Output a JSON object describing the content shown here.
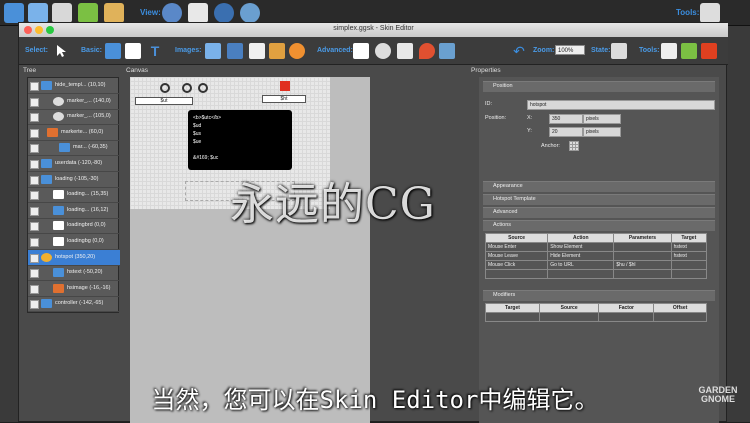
{
  "top_toolbar": {
    "view_label": "View:",
    "tools_label": "Tools:"
  },
  "window": {
    "title": "simplex.ggsk - Skin Editor"
  },
  "toolbar": {
    "select_label": "Select:",
    "basic_label": "Basic:",
    "images_label": "Images:",
    "advanced_label": "Advanced:",
    "zoom_label": "Zoom:",
    "zoom_value": "100%",
    "state_label": "State:",
    "tools_label": "Tools:"
  },
  "panels": {
    "tree": "Tree",
    "canvas": "Canvas",
    "properties": "Properties"
  },
  "tree_items": [
    {
      "label": "hide_templ... (10,10)",
      "indent": 0,
      "kind": "folder"
    },
    {
      "label": "marker_... (140,0)",
      "indent": 2,
      "kind": "circle"
    },
    {
      "label": "marker_... (105,0)",
      "indent": 2,
      "kind": "circle"
    },
    {
      "label": "markerte... (60,0)",
      "indent": 1,
      "kind": "marker"
    },
    {
      "label": "mar... (-60,35)",
      "indent": 3,
      "kind": "text"
    },
    {
      "label": "userdata (-120,-80)",
      "indent": 0,
      "kind": "folder"
    },
    {
      "label": "loading (-105,-30)",
      "indent": 0,
      "kind": "folder"
    },
    {
      "label": "loading... (15,35)",
      "indent": 2,
      "kind": "rect"
    },
    {
      "label": "loading... (16,12)",
      "indent": 2,
      "kind": "text"
    },
    {
      "label": "loadingbrd (0,0)",
      "indent": 2,
      "kind": "rect"
    },
    {
      "label": "loadingbg (0,0)",
      "indent": 2,
      "kind": "rect"
    },
    {
      "label": "hotspot (350,20)",
      "indent": 0,
      "kind": "hotspot",
      "selected": true
    },
    {
      "label": "hstext (-50,20)",
      "indent": 2,
      "kind": "text"
    },
    {
      "label": "hsimage (-16,-16)",
      "indent": 2,
      "kind": "marker"
    },
    {
      "label": "controller (-142,-65)",
      "indent": 0,
      "kind": "folder"
    }
  ],
  "canvas": {
    "label_ut": "$ut",
    "label_ht": "$ht",
    "textbox_lines": [
      "<b>$utc</b>",
      "$ud",
      "$us",
      "$ue",
      "",
      "&#169; $uc"
    ]
  },
  "properties": {
    "position_header": "Position",
    "id_label": "ID:",
    "id_value": "hotspot",
    "position_label": "Position:",
    "x_label": "X:",
    "x_value": "350",
    "y_label": "Y:",
    "y_value": "20",
    "unit": "pixels",
    "anchor_label": "Anchor:",
    "appearance_header": "Appearance",
    "hotspot_template_header": "Hotspot Template",
    "advanced_header": "Advanced",
    "actions_header": "Actions",
    "actions_columns": [
      "Source",
      "Action",
      "Parameters",
      "Target"
    ],
    "actions_rows": [
      [
        "Mouse Enter",
        "Show Element",
        "",
        "hstext"
      ],
      [
        "Mouse Leave",
        "Hide Element",
        "",
        "hstext"
      ],
      [
        "Mouse Click",
        "Go to URL",
        "$hu / $hl",
        ""
      ],
      [
        "",
        "",
        "",
        ""
      ]
    ],
    "modifiers_header": "Modifiers",
    "modifiers_columns": [
      "Target",
      "Source",
      "Factor",
      "Offset"
    ]
  },
  "overlay": {
    "watermark": "永远的CG",
    "subtitle": "当然，您可以在Skin Editor中编辑它。",
    "brand_line1": "GARDEN",
    "brand_line2": "GNOME"
  }
}
